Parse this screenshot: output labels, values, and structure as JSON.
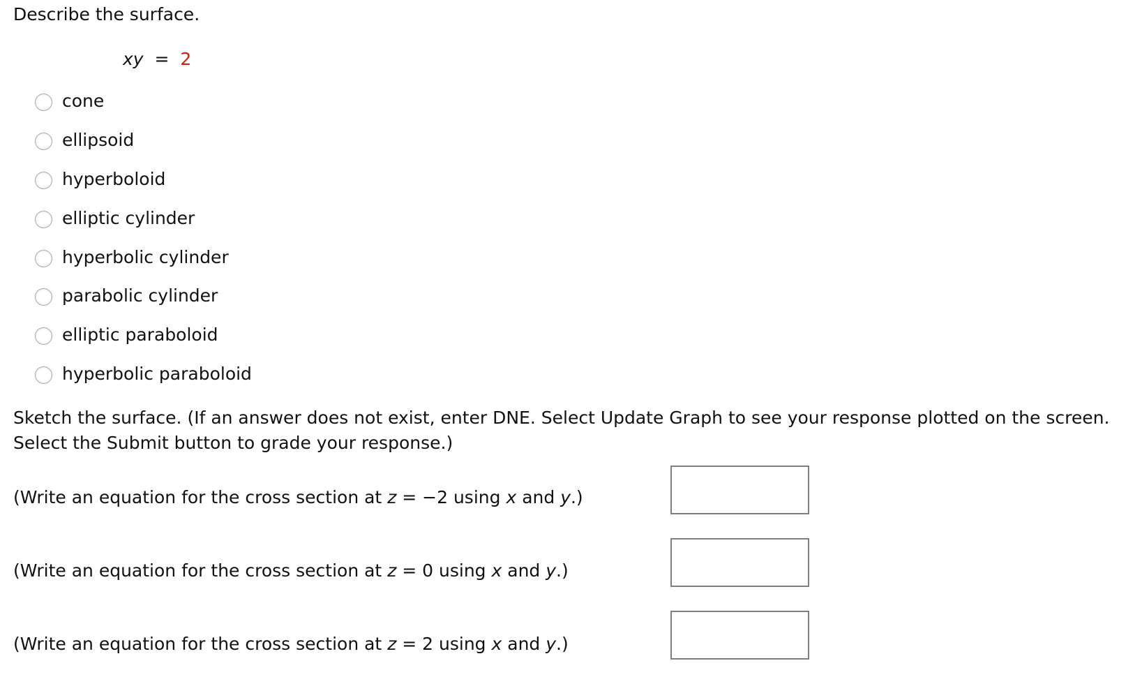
{
  "question": {
    "title": "Describe the surface.",
    "equation": {
      "lhs": "xy",
      "equals": "=",
      "rhs": "2"
    }
  },
  "options": [
    {
      "label": "cone",
      "selected": false
    },
    {
      "label": "ellipsoid",
      "selected": false
    },
    {
      "label": "hyperboloid",
      "selected": false
    },
    {
      "label": "elliptic cylinder",
      "selected": false
    },
    {
      "label": "hyperbolic cylinder",
      "selected": false
    },
    {
      "label": "parabolic cylinder",
      "selected": false
    },
    {
      "label": "elliptic paraboloid",
      "selected": false
    },
    {
      "label": "hyperbolic paraboloid",
      "selected": false
    }
  ],
  "sketch": {
    "instructions": "Sketch the surface. (If an answer does not exist, enter DNE. Select Update Graph to see your response plotted on the screen. Select the Submit button to grade your response.)",
    "prompts": [
      {
        "prefix": "(Write an equation for the cross section at ",
        "var": "z",
        "eq": " = ",
        "value": "−2",
        "mid": " using ",
        "x": "x",
        "and": " and ",
        "y": "y",
        "suffix": ".)",
        "answer": ""
      },
      {
        "prefix": "(Write an equation for the cross section at ",
        "var": "z",
        "eq": " = ",
        "value": "0",
        "mid": " using ",
        "x": "x",
        "and": " and ",
        "y": "y",
        "suffix": ".)",
        "answer": ""
      },
      {
        "prefix": "(Write an equation for the cross section at ",
        "var": "z",
        "eq": " = ",
        "value": "2",
        "mid": " using ",
        "x": "x",
        "and": " and ",
        "y": "y",
        "suffix": ".)",
        "answer": ""
      }
    ]
  },
  "colors": {
    "highlight_red": "#cc2211",
    "input_border": "#7f7f7f",
    "radio_border": "#a9a9a9"
  }
}
